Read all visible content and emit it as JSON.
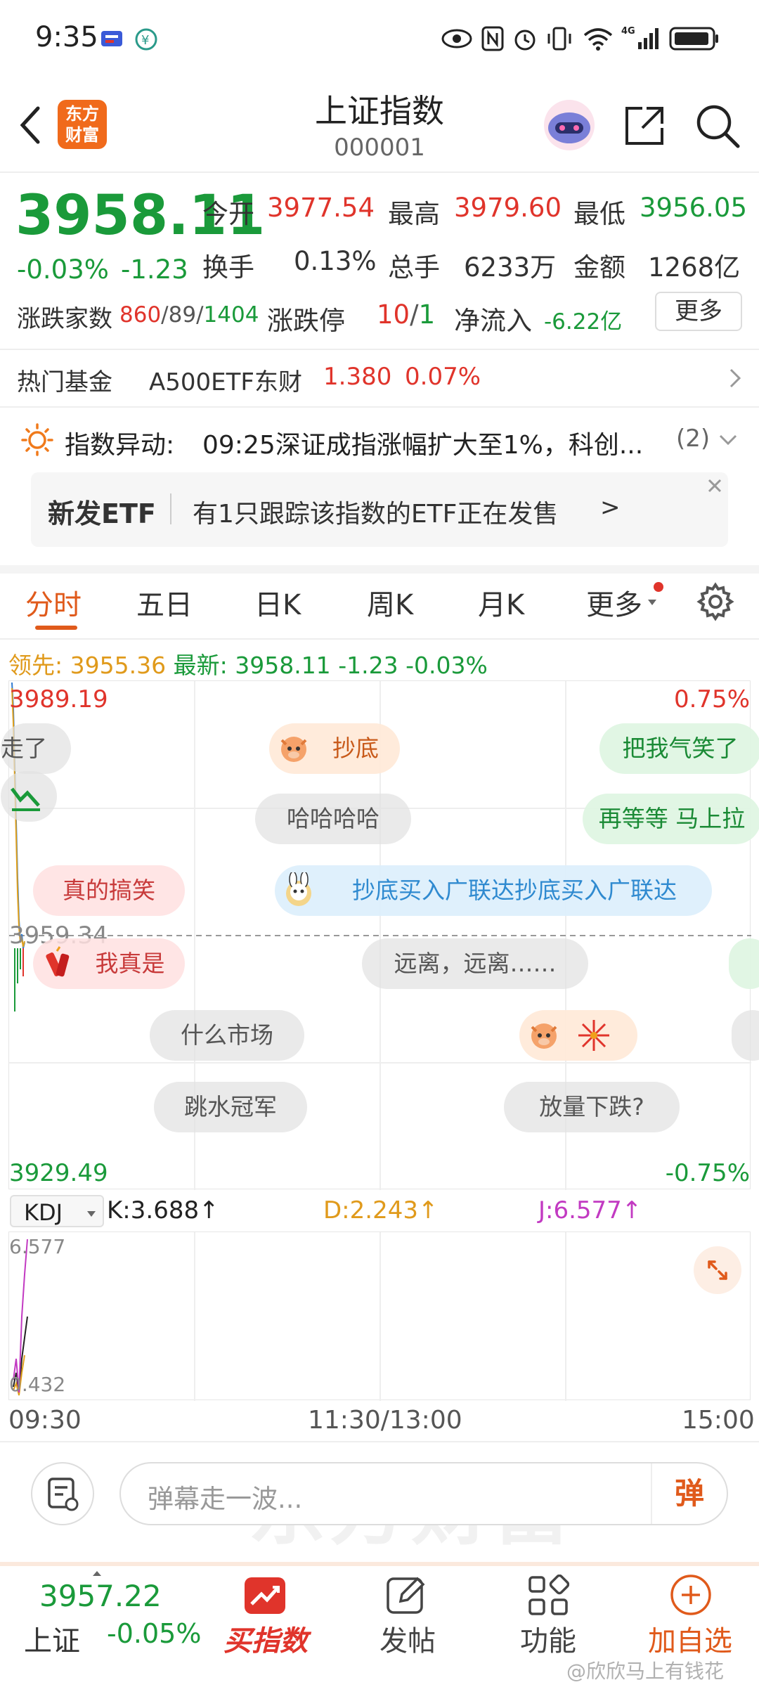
{
  "status_bar": {
    "time": "9:35",
    "network": "4G"
  },
  "header": {
    "logo_text_line1": "东方",
    "logo_text_line2": "财富",
    "title": "上证指数",
    "code": "000001"
  },
  "quote": {
    "price": "3958.11",
    "change_pct": "-0.03%",
    "change": "-1.23",
    "open_label": "今开",
    "open": "3977.54",
    "high_label": "最高",
    "high": "3979.60",
    "low_label": "最低",
    "low": "3956.05",
    "turnover_label": "换手",
    "turnover": "0.13%",
    "volume_label": "总手",
    "volume": "6233万",
    "amount_label": "金额",
    "amount": "1268亿",
    "breadth_label": "涨跌家数",
    "breadth_up": "860",
    "breadth_flat": "89",
    "breadth_down": "1404",
    "limit_label": "涨跌停",
    "limit_up": "10",
    "limit_down": "1",
    "inflow_label": "净流入",
    "inflow": "-6.22亿",
    "more": "更多"
  },
  "hot_fund": {
    "label": "热门基金",
    "name": "A500ETF东财",
    "price": "1.380",
    "pct": "0.07%"
  },
  "alert": {
    "label": "指数异动:",
    "text": "09:25深证成指涨幅扩大至1%，科创...",
    "count": "(2)"
  },
  "etf_notice": {
    "badge": "新发ETF",
    "text": "有1只跟踪该指数的ETF正在发售",
    "arrow": ">"
  },
  "tabs": [
    {
      "label": "分时"
    },
    {
      "label": "五日"
    },
    {
      "label": "日K"
    },
    {
      "label": "周K"
    },
    {
      "label": "月K"
    },
    {
      "label": "更多"
    }
  ],
  "chart_info": {
    "lead_label": "领先:",
    "lead_value": "3955.36",
    "latest_label": "最新:",
    "latest_value": "3958.11",
    "change": "-1.23",
    "change_pct": "-0.03%"
  },
  "chart_axis": {
    "top_price": "3989.19",
    "top_pct": "0.75%",
    "bottom_price": "3929.49",
    "bottom_pct": "-0.75%",
    "ref_price": "3959.34",
    "times": [
      "09:30",
      "11:30/13:00",
      "15:00"
    ]
  },
  "danmu": [
    {
      "text": "走了"
    },
    {
      "text": "抄底"
    },
    {
      "text": "把我气笑了"
    },
    {
      "text": "哈哈哈哈"
    },
    {
      "text": "再等等 马上拉"
    },
    {
      "text": "真的搞笑"
    },
    {
      "text": "抄底买入广联达抄底买入广联达"
    },
    {
      "text": "我真是"
    },
    {
      "text": "远离，远离……"
    },
    {
      "text": "什么市场"
    },
    {
      "text": "跳水冠军"
    },
    {
      "text": "放量下跌?"
    }
  ],
  "watermark": "东方财富",
  "kdj": {
    "selector": "KDJ",
    "k": "K:3.688↑",
    "d": "D:2.243↑",
    "j": "J:6.577↑",
    "top": "6.577",
    "bottom": "0.432"
  },
  "danmu_input": {
    "placeholder": "弹幕走一波...",
    "send": "弹"
  },
  "bottom_nav": {
    "index_price": "3957.22",
    "index_name": "上证",
    "index_pct": "-0.05%",
    "buy_index": "买指数",
    "post": "发帖",
    "function": "功能",
    "add_watch": "加自选"
  },
  "weibo_watermark": "@欣欣马上有钱花",
  "colors": {
    "up": "#e0342b",
    "down": "#1a9a3a",
    "accent": "#e05a1b"
  }
}
